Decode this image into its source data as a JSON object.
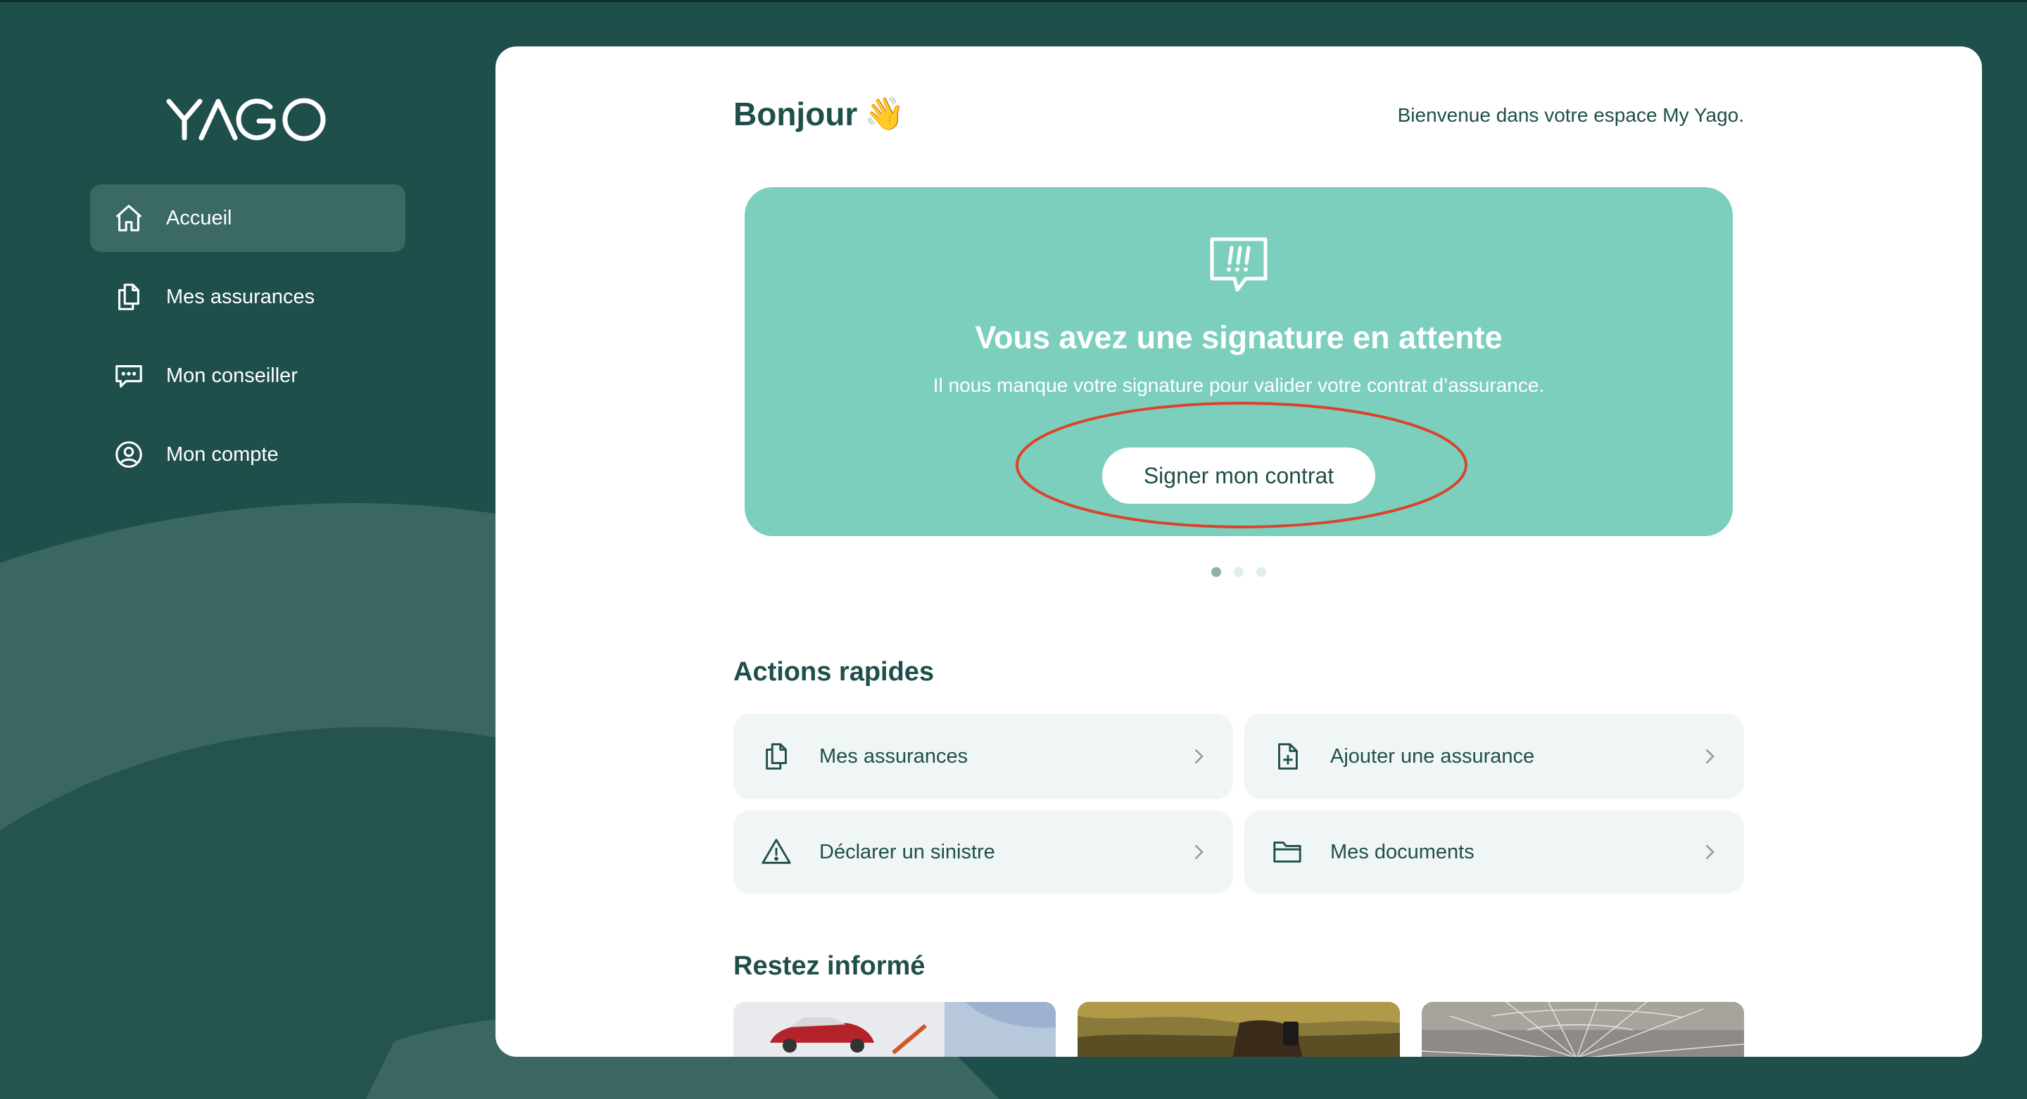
{
  "app": {
    "logo_text": "YAGO",
    "colors": {
      "primary": "#1f4f4a",
      "accent": "#7ccfbd",
      "highlight": "#d9442b",
      "card_bg": "#f0f6f5"
    }
  },
  "sidebar": {
    "items": [
      {
        "label": "Accueil",
        "icon": "home-icon",
        "active": true
      },
      {
        "label": "Mes assurances",
        "icon": "documents-icon",
        "active": false
      },
      {
        "label": "Mon conseiller",
        "icon": "chat-bubble-icon",
        "active": false
      },
      {
        "label": "Mon compte",
        "icon": "user-circle-icon",
        "active": false
      }
    ]
  },
  "header": {
    "greeting": "Bonjour",
    "greeting_emoji": "👋",
    "welcome": "Bienvenue dans votre espace My Yago."
  },
  "banner": {
    "icon": "alert-speech-icon",
    "title": "Vous avez une signature en attente",
    "subtitle": "Il nous manque votre signature pour valider votre contrat d’assurance.",
    "button_label": "Signer mon contrat",
    "carousel_pages": 3,
    "carousel_active": 1
  },
  "quick_actions": {
    "title": "Actions rapides",
    "items": [
      {
        "label": "Mes assurances",
        "icon": "documents-icon"
      },
      {
        "label": "Ajouter une assurance",
        "icon": "file-plus-icon"
      },
      {
        "label": "Déclarer un sinistre",
        "icon": "warning-icon"
      },
      {
        "label": "Mes documents",
        "icon": "folder-icon"
      }
    ]
  },
  "news": {
    "title": "Restez informé",
    "items": [
      {
        "image": "car-toy-photo"
      },
      {
        "image": "phone-driving-photo"
      },
      {
        "image": "cracked-glass-photo"
      }
    ]
  }
}
